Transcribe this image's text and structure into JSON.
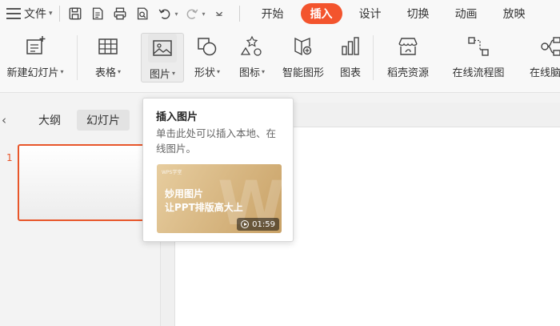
{
  "menubar": {
    "file_label": "文件",
    "tabs": [
      {
        "label": "开始",
        "active": false
      },
      {
        "label": "插入",
        "active": true
      },
      {
        "label": "设计",
        "active": false
      },
      {
        "label": "切换",
        "active": false
      },
      {
        "label": "动画",
        "active": false
      },
      {
        "label": "放映",
        "active": false
      }
    ],
    "accent_color": "#f3542d"
  },
  "ribbon": {
    "new_slide": "新建幻灯片",
    "table": "表格",
    "picture": "图片",
    "shape": "形状",
    "icon": "图标",
    "smart_graphic": "智能图形",
    "chart": "图表",
    "daoke_resources": "稻壳资源",
    "online_flowchart": "在线流程图",
    "online_mindmap": "在线脑图"
  },
  "left_panel": {
    "tab_outline": "大纲",
    "tab_slides": "幻灯片",
    "slide_number": "1"
  },
  "tooltip": {
    "title": "插入图片",
    "description": "单击此处可以插入本地、在线图片。",
    "video": {
      "brand": "WPS学堂",
      "line1": "妙用图片",
      "line2": "让PPT排版高大上",
      "duration": "01:59"
    }
  }
}
